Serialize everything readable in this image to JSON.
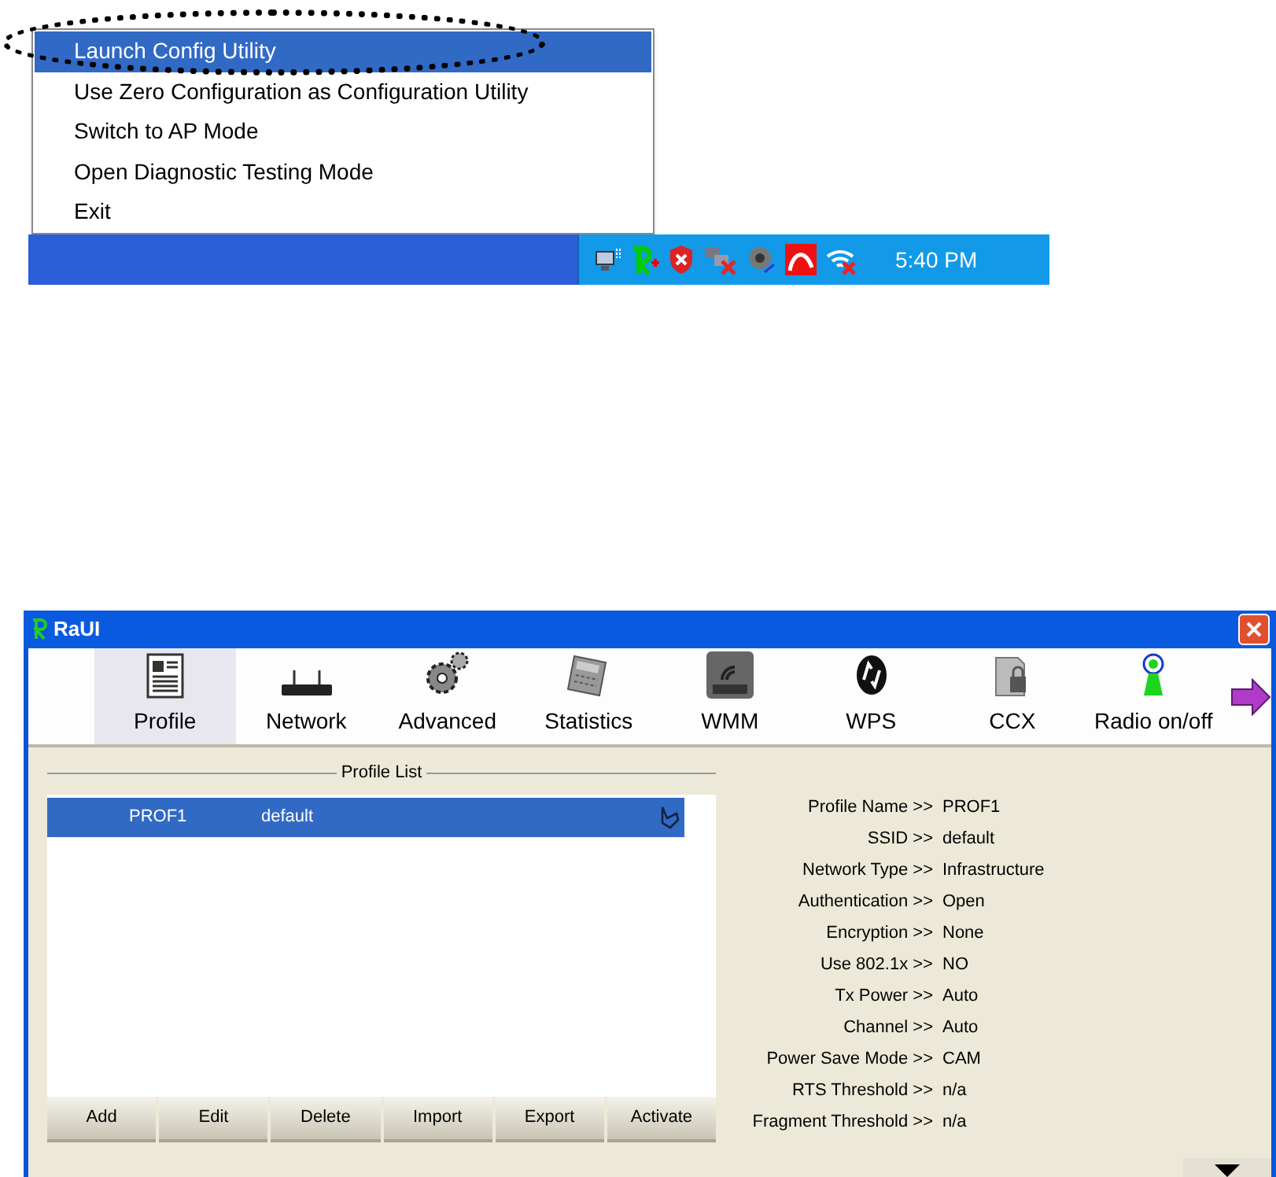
{
  "tray_menu": {
    "items": [
      {
        "label": "Launch Config Utility",
        "selected": true
      },
      {
        "label": "Use Zero Configuration as Configuration Utility",
        "selected": false
      },
      {
        "label": "Switch to AP Mode",
        "selected": false
      },
      {
        "label": "Open Diagnostic Testing Mode",
        "selected": false
      },
      {
        "label": "Exit",
        "selected": false
      }
    ]
  },
  "taskbar": {
    "clock": "5:40 PM"
  },
  "window": {
    "title": "RaUI"
  },
  "toolbar": {
    "items": [
      {
        "label": "Profile",
        "kind": "profile",
        "selected": true
      },
      {
        "label": "Network",
        "kind": "network",
        "selected": false
      },
      {
        "label": "Advanced",
        "kind": "advanced",
        "selected": false
      },
      {
        "label": "Statistics",
        "kind": "statistics",
        "selected": false
      },
      {
        "label": "WMM",
        "kind": "wmm",
        "selected": false
      },
      {
        "label": "WPS",
        "kind": "wps",
        "selected": false
      },
      {
        "label": "CCX",
        "kind": "ccx",
        "selected": false
      },
      {
        "label": "Radio on/off",
        "kind": "radio",
        "selected": false
      }
    ]
  },
  "profile_list": {
    "title": "Profile List",
    "rows": [
      {
        "name": "PROF1",
        "ssid": "default",
        "selected": true
      }
    ],
    "buttons": [
      "Add",
      "Edit",
      "Delete",
      "Import",
      "Export",
      "Activate"
    ]
  },
  "details": [
    {
      "label": "Profile Name >>",
      "value": "PROF1"
    },
    {
      "label": "SSID >>",
      "value": "default"
    },
    {
      "label": "Network Type >>",
      "value": "Infrastructure"
    },
    {
      "label": "Authentication >>",
      "value": "Open"
    },
    {
      "label": "Encryption >>",
      "value": "None"
    },
    {
      "label": "Use 802.1x >>",
      "value": "NO"
    },
    {
      "label": "Tx Power >>",
      "value": "Auto"
    },
    {
      "label": "Channel >>",
      "value": "Auto"
    },
    {
      "label": "Power Save Mode >>",
      "value": "CAM"
    },
    {
      "label": "RTS Threshold >>",
      "value": "n/a"
    },
    {
      "label": "Fragment Threshold >>",
      "value": "n/a"
    }
  ]
}
